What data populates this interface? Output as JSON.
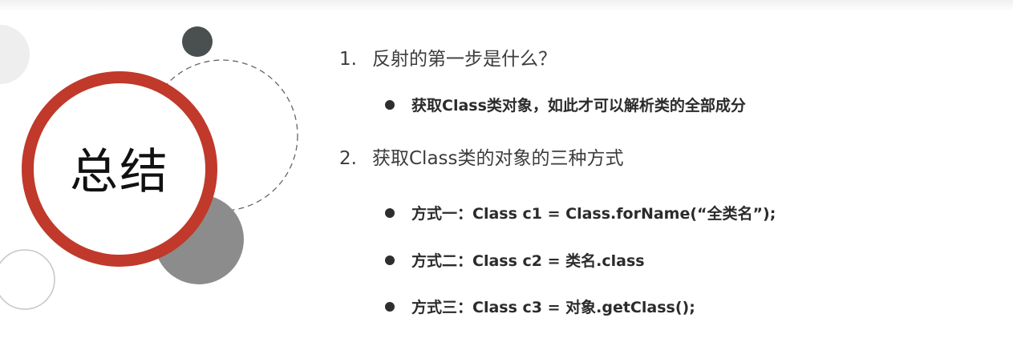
{
  "title": "总结",
  "questions": [
    {
      "number": "1.",
      "text": "反射的第一步是什么？",
      "bullets": [
        "获取Class类对象，如此才可以解析类的全部成分"
      ]
    },
    {
      "number": "2.",
      "text": "获取Class类的对象的三种方式",
      "bullets": [
        "方式一：Class c1 = Class.forName(“全类名”);",
        "方式二：Class c2 = 类名.class",
        "方式三：Class c3 = 对象.getClass();"
      ]
    }
  ],
  "colors": {
    "accent_ring": "#c0392b",
    "dark_dot": "#4a4f4f",
    "gray_circle": "#8c8c8c",
    "light_circle": "#eeeeee"
  }
}
